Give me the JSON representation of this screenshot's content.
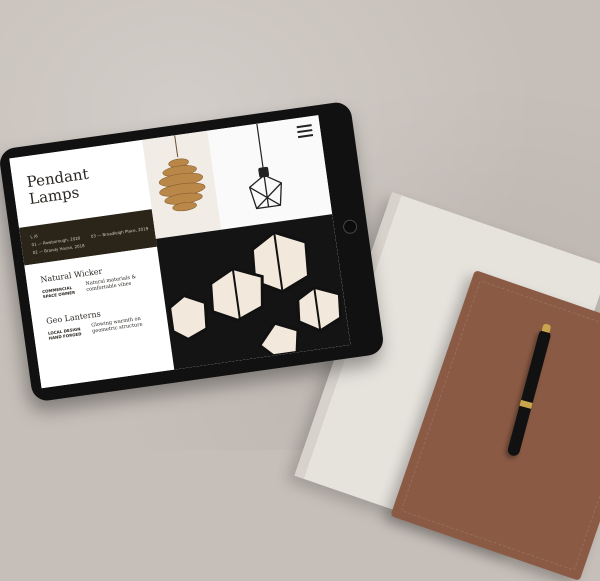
{
  "scene": {
    "description_colors": {
      "concrete": "#c6bfb9",
      "white_notebook": "#e6e2dc",
      "leather_notebook": "#8a5a44",
      "pen_gold": "#c9a54b"
    }
  },
  "tablet_page": {
    "title_line1": "Pendant",
    "title_line2": "Lamps",
    "band": {
      "label": "L /6",
      "items": [
        "01 — Rowborough, 2020",
        "02 — Brandy House, 2018",
        "03 — Broadleigh Place, 2019"
      ]
    },
    "sections": [
      {
        "title": "Natural Wicker",
        "sub_line1": "COMMERCIAL",
        "sub_line2": "SPACE OWNER",
        "desc_line1": "Natural materials &",
        "desc_line2": "comfortable vibes"
      },
      {
        "title": "Geo Lanterns",
        "sub_line1": "LOCAL DESIGN",
        "sub_line2": "HAND FORGED",
        "desc_line1": "Glowing warmth on",
        "desc_line2": "geometric structure"
      }
    ],
    "images": [
      "wicker-pendant",
      "geometric-cage-pendant",
      "geo-lantern-cluster"
    ],
    "menu_icon": "hamburger-menu-icon",
    "accent_dark": "#2b2419"
  }
}
